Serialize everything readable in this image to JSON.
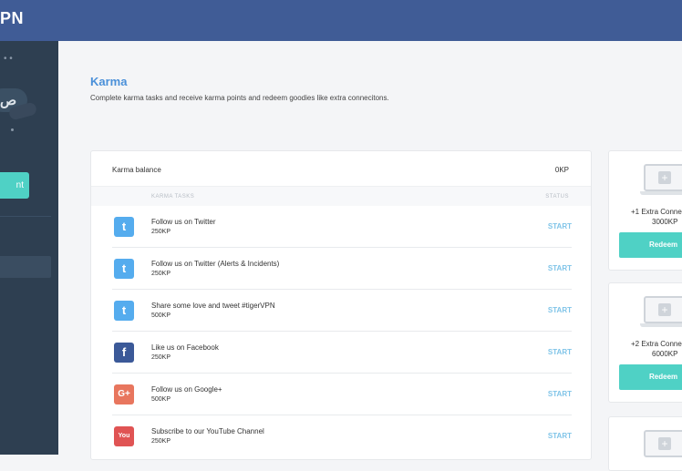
{
  "app": {
    "logo_text": "PN"
  },
  "sidebar": {
    "button_label": "nt",
    "avatar_mark": "ص"
  },
  "page": {
    "title": "Karma",
    "subtitle": "Complete karma tasks and receive karma points and redeem goodies like extra connecitons."
  },
  "balance": {
    "label": "Karma balance",
    "value": "0KP"
  },
  "table": {
    "col_tasks": "KARMA TASKS",
    "col_status": "STATUS"
  },
  "tasks": [
    {
      "icon": "twitter-icon",
      "glyph": "t",
      "name": "Follow us on Twitter",
      "points": "250KP",
      "action": "START"
    },
    {
      "icon": "twitter-icon",
      "glyph": "t",
      "name": "Follow us on Twitter (Alerts & Incidents)",
      "points": "250KP",
      "action": "START"
    },
    {
      "icon": "twitter-icon",
      "glyph": "t",
      "name": "Share some love and tweet #tigerVPN",
      "points": "500KP",
      "action": "START"
    },
    {
      "icon": "facebook-icon",
      "glyph": "f",
      "name": "Like us on Facebook",
      "points": "250KP",
      "action": "START"
    },
    {
      "icon": "google-plus-icon",
      "glyph": "G+",
      "name": "Follow us on Google+",
      "points": "500KP",
      "action": "START"
    },
    {
      "icon": "youtube-icon",
      "glyph": "You",
      "name": "Subscribe to our YouTube Channel",
      "points": "250KP",
      "action": "START"
    }
  ],
  "rewards": [
    {
      "name": "+1 Extra Conne",
      "cost": "3000KP",
      "button": "Redeem"
    },
    {
      "name": "+2 Extra Connec",
      "cost": "6000KP",
      "button": "Redeem"
    },
    {
      "name": "",
      "cost": "",
      "button": ""
    }
  ],
  "colors": {
    "topbar": "#405c96",
    "sidebar": "#2e3f51",
    "accent": "#4fd1c5",
    "title": "#4a90d9",
    "start": "#7fc4e8"
  }
}
